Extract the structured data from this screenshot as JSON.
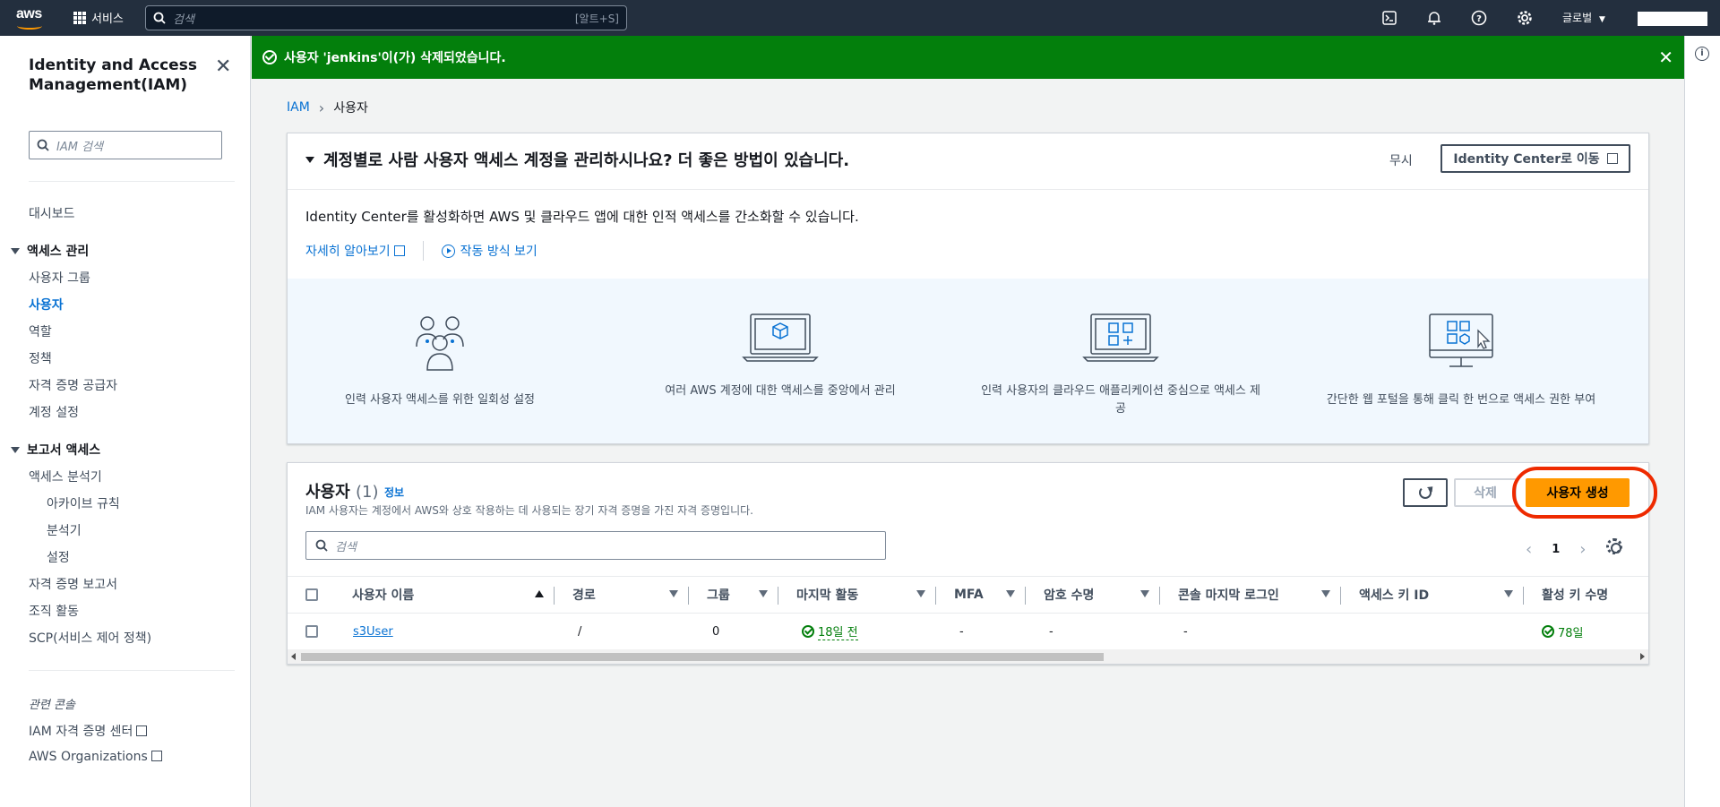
{
  "topnav": {
    "logo": "aws",
    "services_label": "서비스",
    "search_placeholder": "검색",
    "search_shortcut": "[알트+S]",
    "region_label": "글로벌",
    "icons": [
      "cloudshell-icon",
      "notifications-icon",
      "help-icon",
      "settings-icon"
    ]
  },
  "sidebar": {
    "title": "Identity and Access Management(IAM)",
    "search_placeholder": "IAM 검색",
    "dashboard": "대시보드",
    "access_mgmt": {
      "label": "액세스 관리",
      "items": [
        "사용자 그룹",
        "사용자",
        "역할",
        "정책",
        "자격 증명 공급자",
        "계정 설정"
      ]
    },
    "access_reports": {
      "label": "보고서 액세스",
      "items": [
        "액세스 분석기",
        "아카이브 규칙",
        "분석기",
        "설정",
        "자격 증명 보고서",
        "조직 활동",
        "SCP(서비스 제어 정책)"
      ]
    },
    "related_label": "관련 콘솔",
    "related": [
      "IAM 자격 증명 센터",
      "AWS Organizations"
    ]
  },
  "flash": {
    "message": "사용자 'jenkins'이(가) 삭제되었습니다.",
    "color": "#037f0c"
  },
  "breadcrumb": {
    "root": "IAM",
    "current": "사용자"
  },
  "promo": {
    "heading": "계정별로 사람 사용자 액세스 계정을 관리하시나요? 더 좋은 방법이 있습니다.",
    "dismiss": "무시",
    "goto": "Identity Center로 이동",
    "description": "Identity Center를 활성화하면 AWS 및 클라우드 앱에 대한 인적 액세스를 간소화할 수 있습니다.",
    "learn_more": "자세히 알아보기",
    "how_it_works": "작동 방식 보기",
    "features": [
      "인력 사용자 액세스를 위한 일회성 설정",
      "여러 AWS 계정에 대한 액세스를 중앙에서 관리",
      "인력 사용자의 클라우드 애플리케이션 중심으로 액세스 제공",
      "간단한 웹 포털을 통해 클릭 한 번으로 액세스 권한 부여"
    ]
  },
  "users": {
    "title": "사용자",
    "count": "(1)",
    "info": "정보",
    "description": "IAM 사용자는 계정에서 AWS와 상호 작용하는 데 사용되는 장기 자격 증명을 가진 자격 증명입니다.",
    "delete_label": "삭제",
    "create_label": "사용자 생성",
    "search_placeholder": "검색",
    "page": "1",
    "columns": [
      "사용자 이름",
      "경로",
      "그룹",
      "마지막 활동",
      "MFA",
      "암호 수명",
      "콘솔 마지막 로그인",
      "액세스 키 ID",
      "활성 키 수명"
    ],
    "rows": [
      {
        "name": "s3User",
        "path": "/",
        "groups": "0",
        "last_activity": "18일 전",
        "mfa": "-",
        "password_age": "-",
        "console_last_login": "-",
        "access_key_id": "",
        "active_key_age": "78일"
      }
    ]
  },
  "colors": {
    "accent": "#0972d3",
    "primary_button": "#ff9900",
    "success": "#037f0c",
    "highlight_ring": "#ee2a00",
    "nav_bg": "#232f3e"
  }
}
